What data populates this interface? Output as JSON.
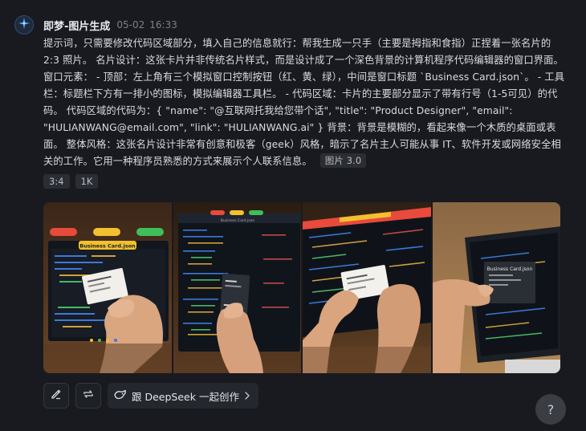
{
  "header": {
    "title": "即梦-图片生成",
    "date": "05-02",
    "time": "16:33"
  },
  "prompt": {
    "text": "提示词，只需要修改代码区域部分，填入自己的信息就行：帮我生成一只手（主要是拇指和食指）正捏着一张名片的 2:3 照片。 名片设计：这张卡片并非传统名片样式，而是设计成了一个深色背景的计算机程序代码编辑器的窗口界面。 窗口元素： - 顶部：左上角有三个模拟窗口控制按钮（红、黄、绿），中间是窗口标题 `Business Card.json`。 - 工具栏：标题栏下方有一排小的图标，模拟编辑器工具栏。 - 代码区域：卡片的主要部分显示了带有行号（1-5可见）的代码。 代码区域的代码为：{ \"name\": \"@互联网托我给您带个话\", \"title\": \"Product Designer\", \"email\": \"HULIANWANG@email.com\", \"link\": \"HULIANWANG.ai\" } 背景：背景是模糊的，看起来像一个木质的桌面或表面。 整体风格：这张名片设计非常有创意和极客（geek）风格，暗示了名片主人可能从事 IT、软件开发或网络安全相关的工作。它用一种程序员熟悉的方式来展示个人联系信息。",
    "model_badge": "图片 3.0"
  },
  "tags": [
    "3:4",
    "1K"
  ],
  "gallery": {
    "images": [
      {
        "card_title": "Business Card.json",
        "desc": "hand-holding-card-over-laptop"
      },
      {
        "card_title": "Business Card.json",
        "desc": "hand-holding-dark-card-over-editor"
      },
      {
        "card_title": "",
        "desc": "hand-holding-white-card-over-laptop"
      },
      {
        "card_title": "Business Card.json",
        "desc": "hand-holding-card-over-tablet"
      }
    ]
  },
  "actions": {
    "deepseek_label": "跟 DeepSeek 一起创作"
  },
  "help": {
    "label": "?"
  },
  "colors": {
    "background": "#181a1f",
    "avatar_accent": "#4aa3ff",
    "window_red": "#e84a3c",
    "window_yellow": "#f2c12e",
    "window_green": "#3fbf5a"
  }
}
